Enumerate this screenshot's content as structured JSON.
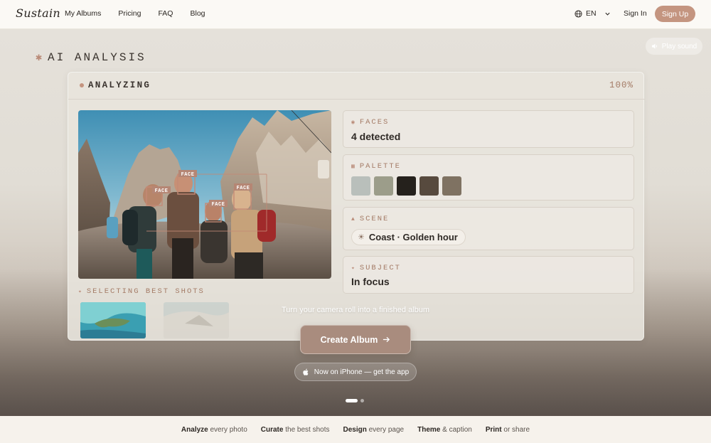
{
  "nav": {
    "logo": "Sustain",
    "links": [
      "My Albums",
      "Pricing",
      "FAQ",
      "Blog"
    ],
    "language": "EN",
    "signin": "Sign In",
    "signup": "Sign Up"
  },
  "hero": {
    "section_title": "AI ANALYSIS",
    "play_sound": "Play sound",
    "panel": {
      "status": "ANALYZING",
      "progress": "100%",
      "face_tags": [
        "FACE",
        "FACE",
        "FACE",
        "FACE"
      ],
      "faces": {
        "title": "FACES",
        "value": "4 detected"
      },
      "palette": {
        "title": "PALETTE",
        "colors": [
          "#b9bfbb",
          "#9c9d8a",
          "#25211c",
          "#574a3e",
          "#7f7262"
        ]
      },
      "scene": {
        "title": "SCENE",
        "value": "Coast · Golden hour"
      },
      "subject": {
        "title": "SUBJECT",
        "value": "In focus"
      },
      "best_shots": "SELECTING BEST SHOTS"
    },
    "tagline": "Turn your camera roll into a finished album",
    "cta": "Create Album",
    "iphone": "Now on iPhone — get the app"
  },
  "footer": [
    {
      "bold": "Analyze",
      "rest": "every photo"
    },
    {
      "bold": "Curate",
      "rest": "the best shots"
    },
    {
      "bold": "Design",
      "rest": "every page"
    },
    {
      "bold": "Theme",
      "rest": "& caption"
    },
    {
      "bold": "Print",
      "rest": "or share"
    }
  ]
}
